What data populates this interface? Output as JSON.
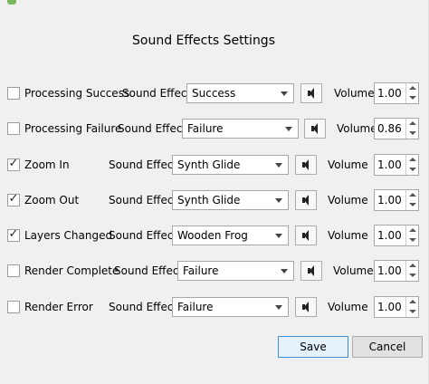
{
  "dialog": {
    "title": "Sound Effects Settings",
    "sound_effect_label": "Sound Effect",
    "volume_label": "Volume"
  },
  "rows": [
    {
      "event": "Processing Success",
      "checked": false,
      "effect": "Success",
      "volume": "1.00"
    },
    {
      "event": "Processing Failure",
      "checked": false,
      "effect": "Failure",
      "volume": "0.86"
    },
    {
      "event": "Zoom In",
      "checked": true,
      "effect": "Synth Glide",
      "volume": "1.00"
    },
    {
      "event": "Zoom Out",
      "checked": true,
      "effect": "Synth Glide",
      "volume": "1.00"
    },
    {
      "event": "Layers Changed",
      "checked": true,
      "effect": "Wooden Frog",
      "volume": "1.00"
    },
    {
      "event": "Render Complete",
      "checked": false,
      "effect": "Failure",
      "volume": "1.00"
    },
    {
      "event": "Render Error",
      "checked": false,
      "effect": "Failure",
      "volume": "1.00"
    }
  ],
  "buttons": {
    "save": "Save",
    "cancel": "Cancel"
  },
  "icons": {
    "play": "speaker-icon",
    "check": "✓"
  },
  "colors": {
    "default_button_border": "#3c8fd8",
    "logo": "#79b85a"
  }
}
